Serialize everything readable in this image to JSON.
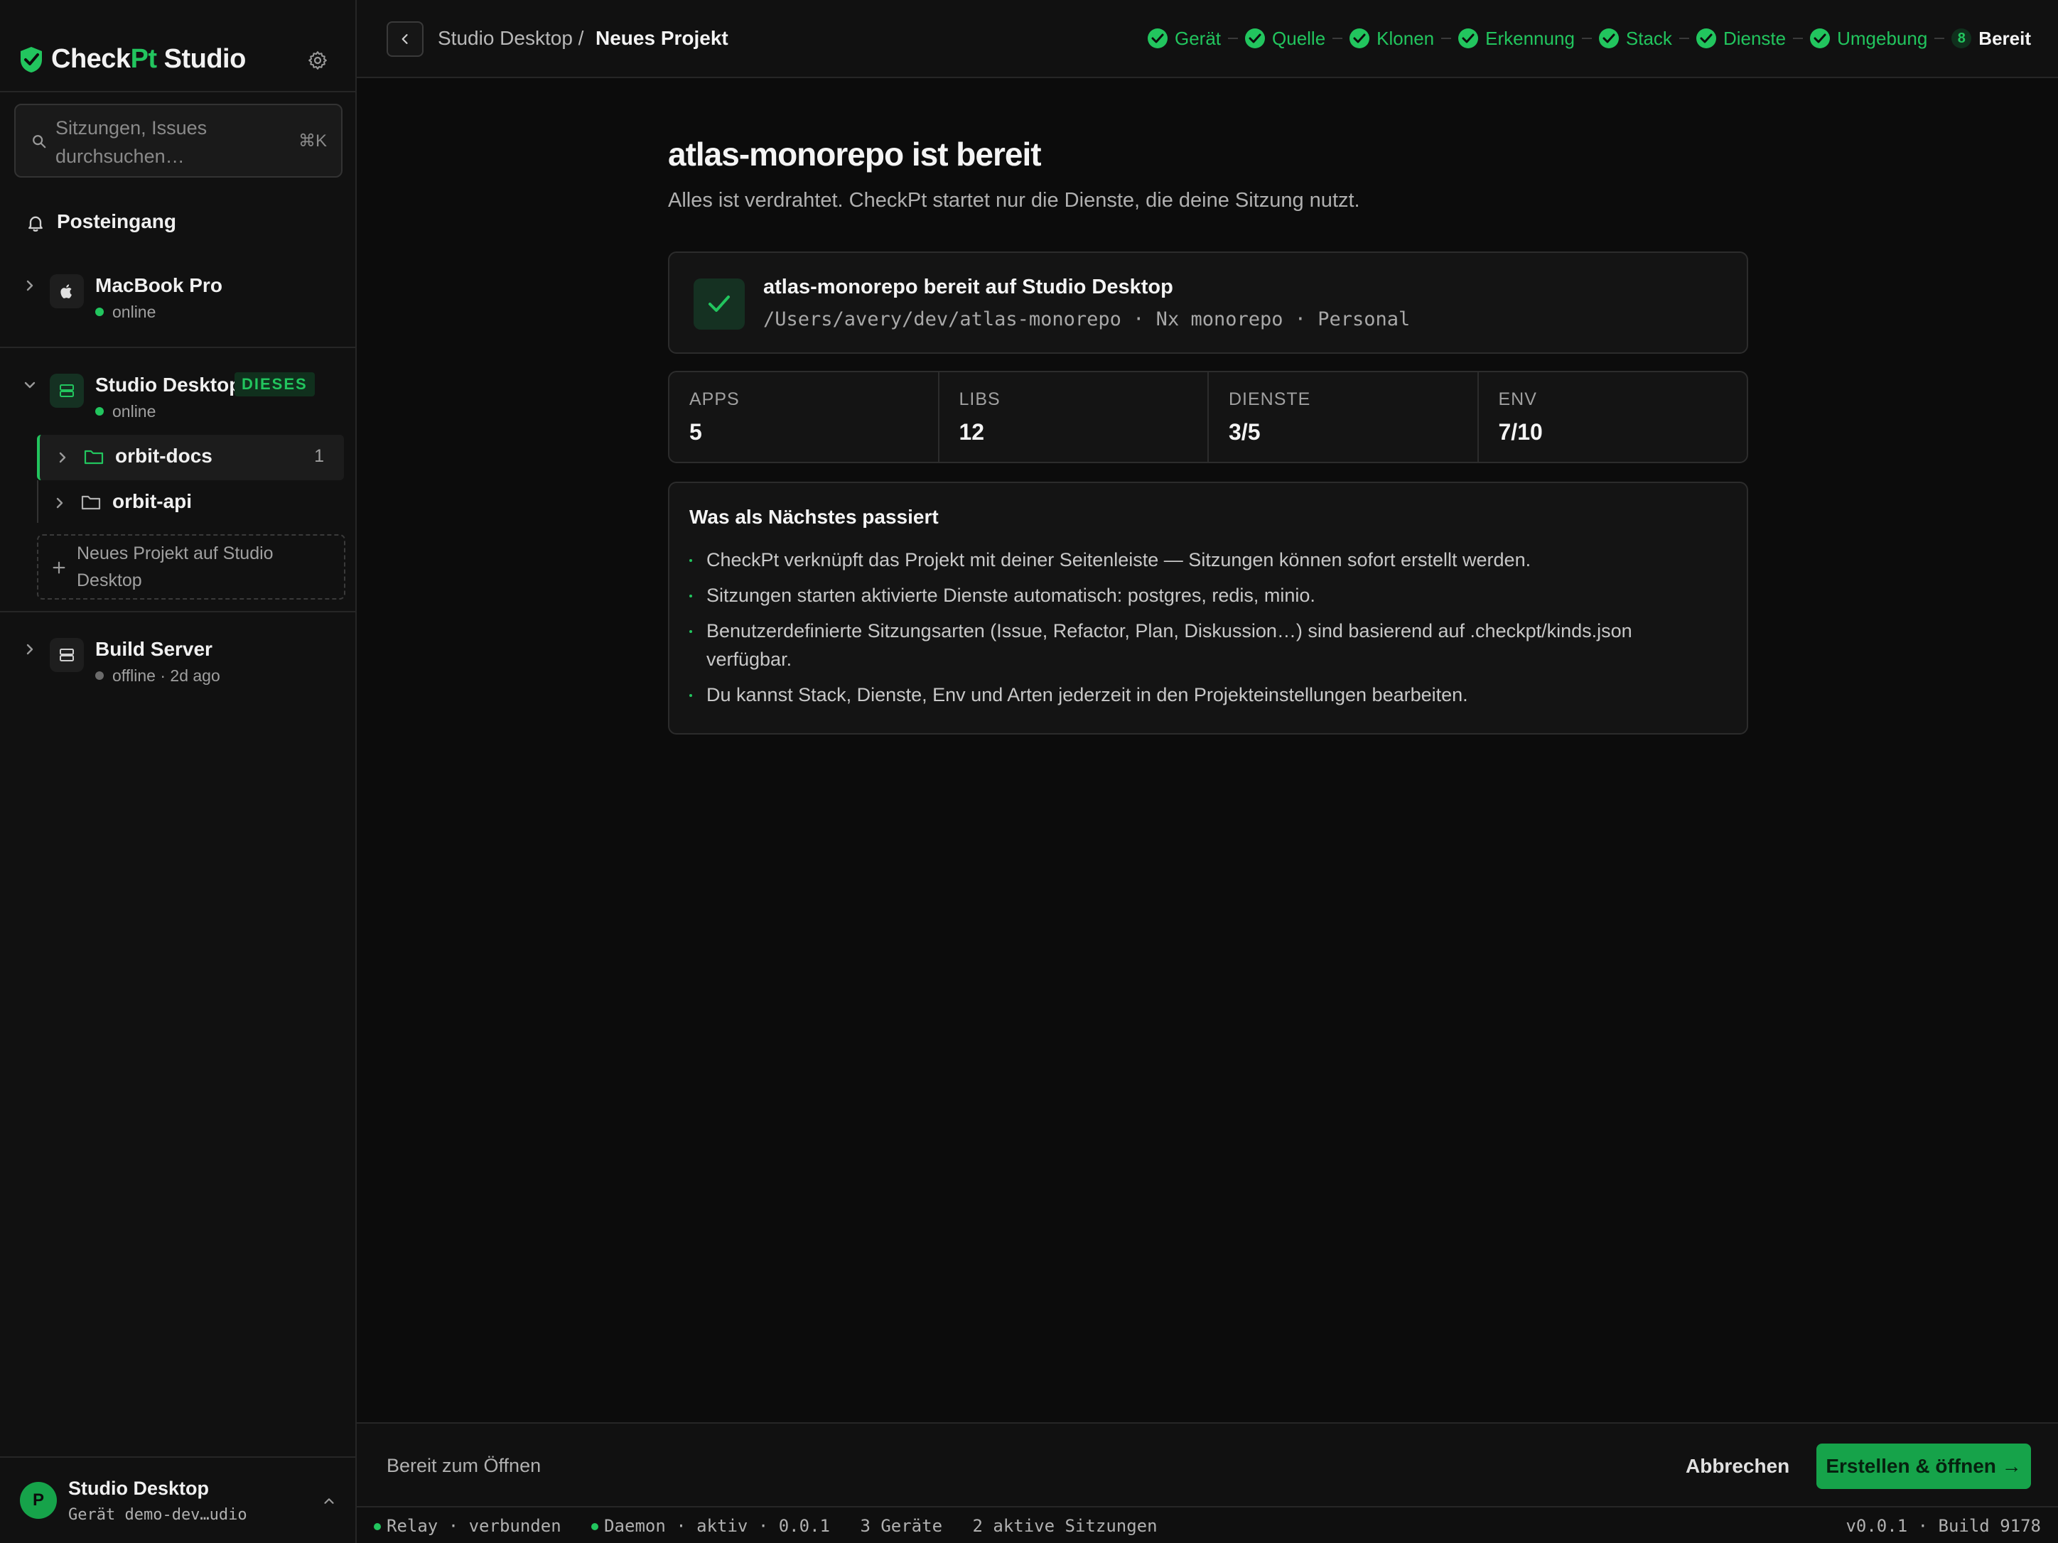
{
  "app": {
    "brand_prefix": "Check",
    "brand_accent": "Pt",
    "brand_suffix": " Studio",
    "accent_color": "#22c55e"
  },
  "sidebar": {
    "search_placeholder": "Sitzungen, Issues durchsuchen…",
    "search_shortcut": "⌘K",
    "inbox_label": "Posteingang",
    "devices": [
      {
        "name": "MacBook Pro",
        "status": "online",
        "icon": "apple-icon"
      },
      {
        "name": "Studio Desktop",
        "status": "online",
        "badge": "DIESES",
        "icon": "server-icon",
        "projects": [
          {
            "name": "orbit-docs",
            "count": "1"
          },
          {
            "name": "orbit-api"
          }
        ],
        "new_project_label": "Neues Projekt auf Studio Desktop"
      },
      {
        "name": "Build Server",
        "status": "offline · 2d ago",
        "icon": "server-icon"
      }
    ],
    "user": {
      "initial": "P",
      "name": "Studio Desktop",
      "sub": "Gerät demo-dev…udio"
    }
  },
  "topbar": {
    "breadcrumb_parent": "Studio Desktop /",
    "breadcrumb_current": "Neues Projekt",
    "steps": [
      {
        "label": "Gerät",
        "done": true
      },
      {
        "label": "Quelle",
        "done": true
      },
      {
        "label": "Klonen",
        "done": true
      },
      {
        "label": "Erkennung",
        "done": true
      },
      {
        "label": "Stack",
        "done": true
      },
      {
        "label": "Dienste",
        "done": true
      },
      {
        "label": "Umgebung",
        "done": true
      },
      {
        "label": "Bereit",
        "number": "8",
        "current": true
      }
    ]
  },
  "main": {
    "title": "atlas-monorepo ist bereit",
    "subtitle": "Alles ist verdrahtet. CheckPt startet nur die Dienste, die deine Sitzung nutzt.",
    "ready_card": {
      "title": "atlas-monorepo bereit auf Studio Desktop",
      "path": "/Users/avery/dev/atlas-monorepo · Nx monorepo · Personal"
    },
    "stats": [
      {
        "label": "APPS",
        "value": "5"
      },
      {
        "label": "LIBS",
        "value": "12"
      },
      {
        "label": "DIENSTE",
        "value": "3/5"
      },
      {
        "label": "ENV",
        "value": "7/10"
      }
    ],
    "next": {
      "title": "Was als Nächstes passiert",
      "items": [
        "CheckPt verknüpft das Projekt mit deiner Seitenleiste — Sitzungen können sofort erstellt werden.",
        "Sitzungen starten aktivierte Dienste automatisch: postgres, redis, minio.",
        "Benutzerdefinierte Sitzungsarten (Issue, Refactor, Plan, Diskussion…) sind basierend auf .checkpt/kinds.json verfügbar.",
        "Du kannst Stack, Dienste, Env und Arten jederzeit in den Projekteinstellungen bearbeiten."
      ]
    }
  },
  "footer": {
    "status": "Bereit zum Öffnen",
    "cancel_label": "Abbrechen",
    "create_label": "Erstellen & öffnen →"
  },
  "statusbar": {
    "relay": "Relay · verbunden",
    "daemon": "Daemon · aktiv · 0.0.1",
    "devices": "3 Geräte",
    "sessions": "2 aktive Sitzungen",
    "version": "v0.0.1 · Build 9178"
  }
}
